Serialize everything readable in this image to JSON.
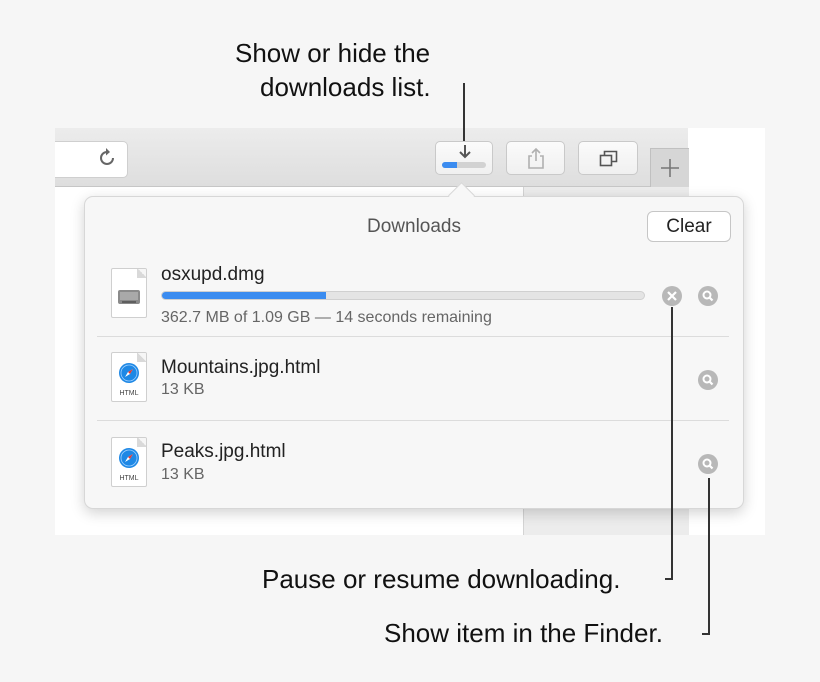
{
  "callouts": {
    "top_line1": "Show or hide the",
    "top_line2": "downloads list.",
    "pause": "Pause or resume downloading.",
    "finder": "Show item in the Finder."
  },
  "toolbar": {
    "download_progress": 0.35
  },
  "downloads": {
    "title": "Downloads",
    "clear_label": "Clear",
    "items": [
      {
        "name": "osxupd.dmg",
        "detail": "362.7 MB of 1.09 GB — 14 seconds remaining",
        "progress": 0.34,
        "icon": "disk-image-icon"
      },
      {
        "name": "Mountains.jpg.html",
        "detail": "13 KB",
        "icon": "html-document-icon",
        "icon_caption": "HTML"
      },
      {
        "name": "Peaks.jpg.html",
        "detail": "13 KB",
        "icon": "html-document-icon",
        "icon_caption": "HTML"
      }
    ]
  },
  "colors": {
    "accent": "#3b8cf0",
    "button_grey": "#b8b8b8"
  }
}
